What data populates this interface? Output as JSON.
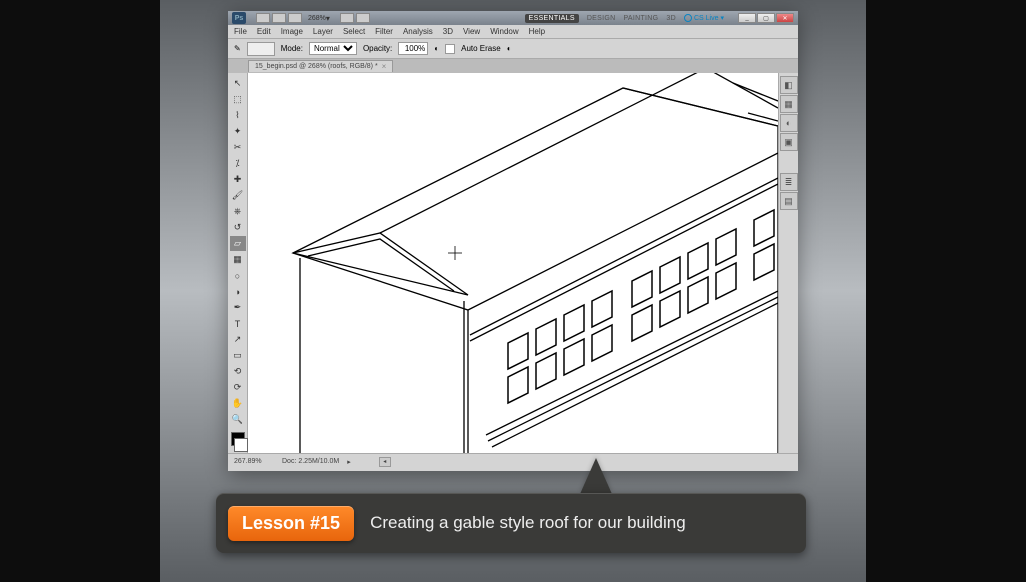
{
  "titlebar": {
    "zoom": "268%"
  },
  "workspaces": {
    "essentials": "ESSENTIALS",
    "design": "DESIGN",
    "painting": "PAINTING",
    "threed": "3D",
    "cslive": "CS Live"
  },
  "menu": {
    "file": "File",
    "edit": "Edit",
    "image": "Image",
    "layer": "Layer",
    "select": "Select",
    "filter": "Filter",
    "analysis": "Analysis",
    "threed": "3D",
    "view": "View",
    "window": "Window",
    "help": "Help"
  },
  "options": {
    "mode_label": "Mode:",
    "mode_value": "Normal",
    "opacity_label": "Opacity:",
    "opacity_value": "100%",
    "auto_erase": "Auto Erase"
  },
  "doctab": {
    "title": "15_begin.psd @ 268% (roofs, RGB/8) *"
  },
  "status": {
    "zoom": "267.89%",
    "doc": "Doc: 2.25M/10.0M"
  },
  "lesson": {
    "badge": "Lesson #15",
    "title": "Creating a gable style roof for our building"
  }
}
